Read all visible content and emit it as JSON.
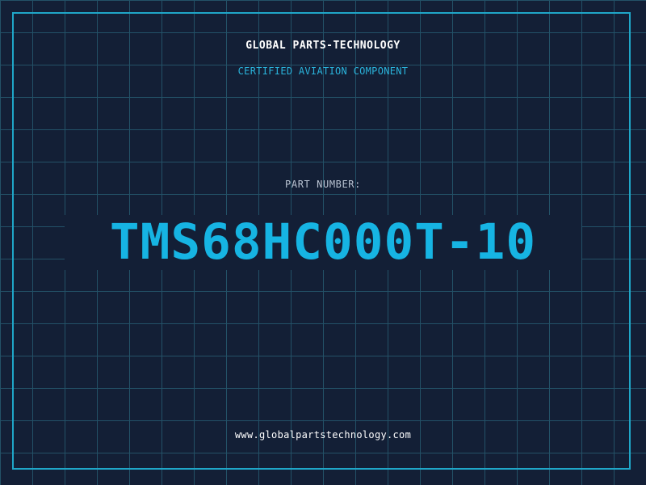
{
  "header": {
    "company": "GLOBAL PARTS-TECHNOLOGY",
    "subtitle": "CERTIFIED AVIATION COMPONENT"
  },
  "main": {
    "part_label": "PART NUMBER:",
    "part_number": "TMS68HC000T-10"
  },
  "footer": {
    "website": "www.globalpartstechnology.com"
  },
  "colors": {
    "background": "#131f36",
    "grid": "#24546a",
    "frame": "#1fa6c8",
    "accent": "#16b4e3",
    "subtitle": "#2ab3db",
    "label": "#b9c3d2",
    "text": "#ffffff"
  }
}
